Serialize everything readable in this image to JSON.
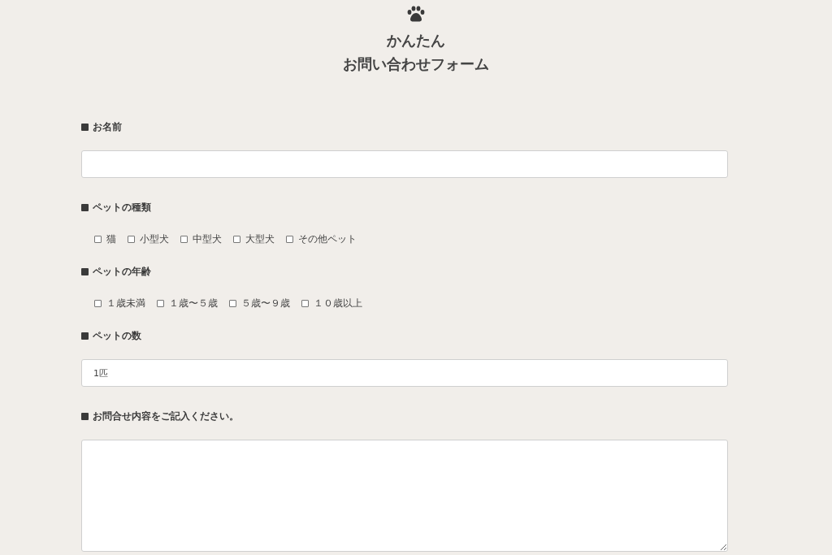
{
  "header": {
    "title_lines": [
      "かんたん",
      "お問い合わせフォーム"
    ]
  },
  "sections": [
    {
      "kind": "text",
      "label": "お名前"
    },
    {
      "kind": "checkboxes",
      "label": "ペットの種類",
      "options": [
        {
          "label": "猫",
          "checked": false
        },
        {
          "label": "小型犬",
          "checked": false
        },
        {
          "label": "中型犬",
          "checked": false
        },
        {
          "label": "大型犬",
          "checked": false
        },
        {
          "label": "その他ペット",
          "checked": false
        }
      ]
    },
    {
      "kind": "checkboxes",
      "label": "ペットの年齢",
      "options": [
        {
          "label": "１歳未満",
          "checked": false
        },
        {
          "label": "１歳〜５歳",
          "checked": false
        },
        {
          "label": "５歳〜９歳",
          "checked": false
        },
        {
          "label": "１０歳以上",
          "checked": false
        }
      ]
    },
    {
      "kind": "text",
      "label": "ペットの数",
      "value": "1匹"
    },
    {
      "kind": "textarea",
      "label": "お問合せ内容をご記入ください。"
    }
  ]
}
